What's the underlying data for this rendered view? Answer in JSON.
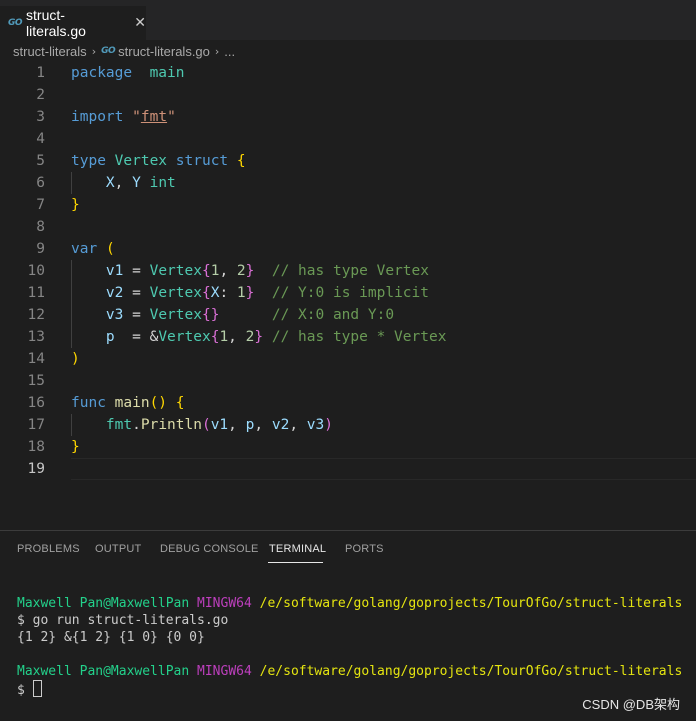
{
  "tab": {
    "icon": "go-file-icon",
    "title": "struct-literals.go",
    "close_glyph": "✕"
  },
  "breadcrumb": {
    "folder": "struct-literals",
    "file": "struct-literals.go",
    "more": "..."
  },
  "editor": {
    "lines": [
      {
        "n": "1",
        "tokens": [
          [
            "kb",
            "package"
          ],
          [
            "",
            "  "
          ],
          [
            "t",
            "main"
          ]
        ]
      },
      {
        "n": "2",
        "tokens": []
      },
      {
        "n": "3",
        "tokens": [
          [
            "kb",
            "import"
          ],
          [
            "",
            " "
          ],
          [
            "s",
            "\""
          ],
          [
            "s ul",
            "fmt"
          ],
          [
            "s",
            "\""
          ]
        ]
      },
      {
        "n": "4",
        "tokens": []
      },
      {
        "n": "5",
        "tokens": [
          [
            "kb",
            "type"
          ],
          [
            "",
            " "
          ],
          [
            "t",
            "Vertex"
          ],
          [
            "",
            " "
          ],
          [
            "kb",
            "struct"
          ],
          [
            "",
            " "
          ],
          [
            "b1",
            "{"
          ]
        ]
      },
      {
        "n": "6",
        "tokens": [
          [
            "",
            "    "
          ],
          [
            "v",
            "X"
          ],
          [
            "",
            ", "
          ],
          [
            "v",
            "Y"
          ],
          [
            "",
            " "
          ],
          [
            "t",
            "int"
          ]
        ]
      },
      {
        "n": "7",
        "tokens": [
          [
            "b1",
            "}"
          ]
        ]
      },
      {
        "n": "8",
        "tokens": []
      },
      {
        "n": "9",
        "tokens": [
          [
            "kb",
            "var"
          ],
          [
            "",
            " "
          ],
          [
            "b1",
            "("
          ]
        ]
      },
      {
        "n": "10",
        "tokens": [
          [
            "",
            "    "
          ],
          [
            "v",
            "v1"
          ],
          [
            "",
            " = "
          ],
          [
            "t",
            "Vertex"
          ],
          [
            "b2",
            "{"
          ],
          [
            "n",
            "1"
          ],
          [
            "",
            ", "
          ],
          [
            "n",
            "2"
          ],
          [
            "b2",
            "}"
          ],
          [
            "",
            "  "
          ],
          [
            "c",
            "// has type Vertex"
          ]
        ]
      },
      {
        "n": "11",
        "tokens": [
          [
            "",
            "    "
          ],
          [
            "v",
            "v2"
          ],
          [
            "",
            " = "
          ],
          [
            "t",
            "Vertex"
          ],
          [
            "b2",
            "{"
          ],
          [
            "v",
            "X"
          ],
          [
            "",
            ": "
          ],
          [
            "n",
            "1"
          ],
          [
            "b2",
            "}"
          ],
          [
            "",
            "  "
          ],
          [
            "c",
            "// Y:0 is implicit"
          ]
        ]
      },
      {
        "n": "12",
        "tokens": [
          [
            "",
            "    "
          ],
          [
            "v",
            "v3"
          ],
          [
            "",
            " = "
          ],
          [
            "t",
            "Vertex"
          ],
          [
            "b2",
            "{}"
          ],
          [
            "",
            "      "
          ],
          [
            "c",
            "// X:0 and Y:0"
          ]
        ]
      },
      {
        "n": "13",
        "tokens": [
          [
            "",
            "    "
          ],
          [
            "v",
            "p"
          ],
          [
            "",
            "  = &"
          ],
          [
            "t",
            "Vertex"
          ],
          [
            "b2",
            "{"
          ],
          [
            "n",
            "1"
          ],
          [
            "",
            ", "
          ],
          [
            "n",
            "2"
          ],
          [
            "b2",
            "}"
          ],
          [
            "",
            " "
          ],
          [
            "c",
            "// has type * Vertex"
          ]
        ]
      },
      {
        "n": "14",
        "tokens": [
          [
            "b1",
            ")"
          ]
        ]
      },
      {
        "n": "15",
        "tokens": []
      },
      {
        "n": "16",
        "tokens": [
          [
            "kb",
            "func"
          ],
          [
            "",
            " "
          ],
          [
            "f",
            "main"
          ],
          [
            "b1",
            "()"
          ],
          [
            "",
            " "
          ],
          [
            "b1",
            "{"
          ]
        ]
      },
      {
        "n": "17",
        "tokens": [
          [
            "",
            "    "
          ],
          [
            "t",
            "fmt"
          ],
          [
            "",
            "."
          ],
          [
            "f",
            "Println"
          ],
          [
            "b2",
            "("
          ],
          [
            "v",
            "v1"
          ],
          [
            "",
            ", "
          ],
          [
            "v",
            "p"
          ],
          [
            "",
            ", "
          ],
          [
            "v",
            "v2"
          ],
          [
            "",
            ", "
          ],
          [
            "v",
            "v3"
          ],
          [
            "b2",
            ")"
          ]
        ]
      },
      {
        "n": "18",
        "tokens": [
          [
            "b1",
            "}"
          ]
        ]
      },
      {
        "n": "19",
        "tokens": []
      }
    ]
  },
  "panel": {
    "tabs": [
      {
        "label": "PROBLEMS",
        "key": "problems"
      },
      {
        "label": "OUTPUT",
        "key": "output"
      },
      {
        "label": "DEBUG CONSOLE",
        "key": "debug-console"
      },
      {
        "label": "TERMINAL",
        "key": "terminal",
        "active": true
      },
      {
        "label": "PORTS",
        "key": "ports"
      }
    ]
  },
  "terminal": {
    "prompt1": {
      "user": "Maxwell Pan@MaxwellPan",
      "env": "MINGW64",
      "path": "/e/software/golang/goprojects/TourOfGo/struct-literals"
    },
    "command": "$ go run struct-literals.go",
    "output": "{1 2} &{1 2} {1 0} {0 0}",
    "prompt2": {
      "user": "Maxwell Pan@MaxwellPan",
      "env": "MINGW64",
      "path": "/e/software/golang/goprojects/TourOfGo/struct-literals"
    },
    "input_prompt": "$"
  },
  "watermark": "CSDN @DB架构"
}
